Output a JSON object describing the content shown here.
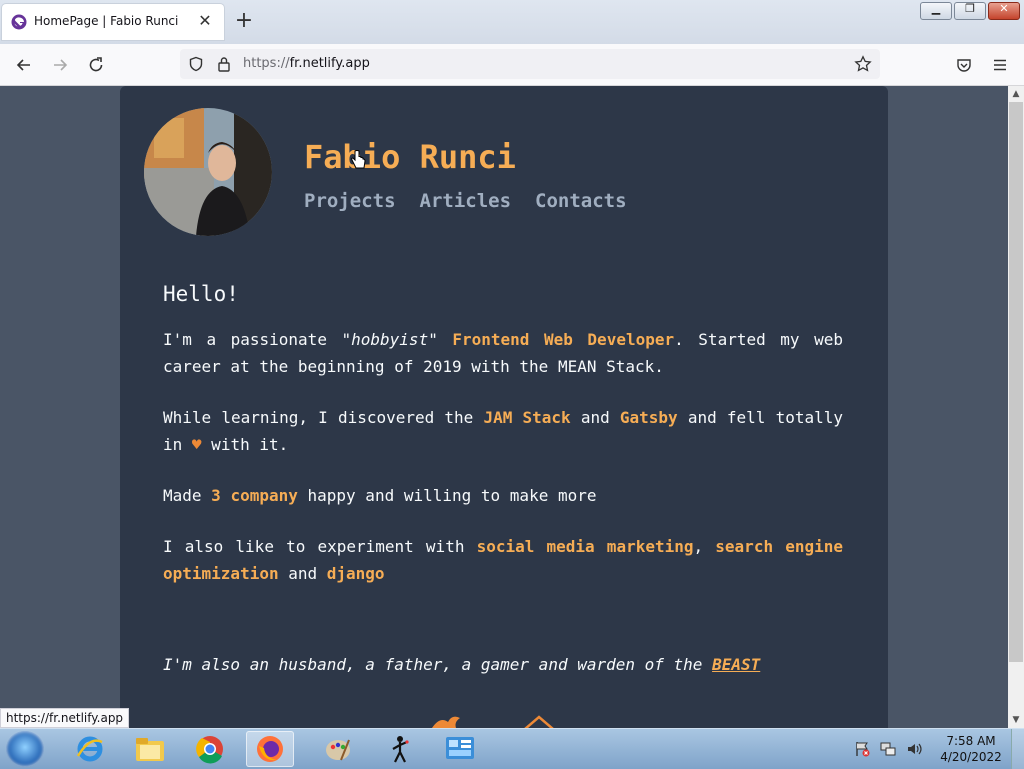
{
  "browser": {
    "tab_title": "HomePage | Fabio Runci",
    "url_protocol": "https://",
    "url_host": "fr.netlify.app",
    "status_url": "https://fr.netlify.app"
  },
  "site": {
    "title": "Fabio Runci",
    "nav": [
      "Projects",
      "Articles",
      "Contacts"
    ]
  },
  "content": {
    "heading": "Hello!",
    "p1": {
      "a": "I'm a passionate ",
      "b": "\"hobbyist\"",
      "c": " ",
      "d": "Frontend Web Developer",
      "e": ". Started my web career at the beginning of 2019 with the MEAN Stack."
    },
    "p2": {
      "a": "While learning, I discovered the ",
      "b": "JAM Stack",
      "c": " and ",
      "d": "Gatsby",
      "e": " and fell totally in ",
      "heart": "♥",
      "f": " with it."
    },
    "p3": {
      "a": "Made ",
      "b": "3 company",
      "c": " happy and willing to make more"
    },
    "p4": {
      "a": "I also like to experiment with ",
      "b": "social media marketing",
      "c": ", ",
      "d": "search engine optimization",
      "e": " and ",
      "f": "django"
    },
    "p5": {
      "a": "I'm also an husband, a father, a gamer and warden of the ",
      "b": "BEAST"
    }
  },
  "taskbar": {
    "time": "7:58 AM",
    "date": "4/20/2022"
  },
  "colors": {
    "accent": "#f6ad55",
    "card_bg": "#2d3748",
    "page_bg": "#4a5566",
    "nav_text": "#a0aec0"
  }
}
